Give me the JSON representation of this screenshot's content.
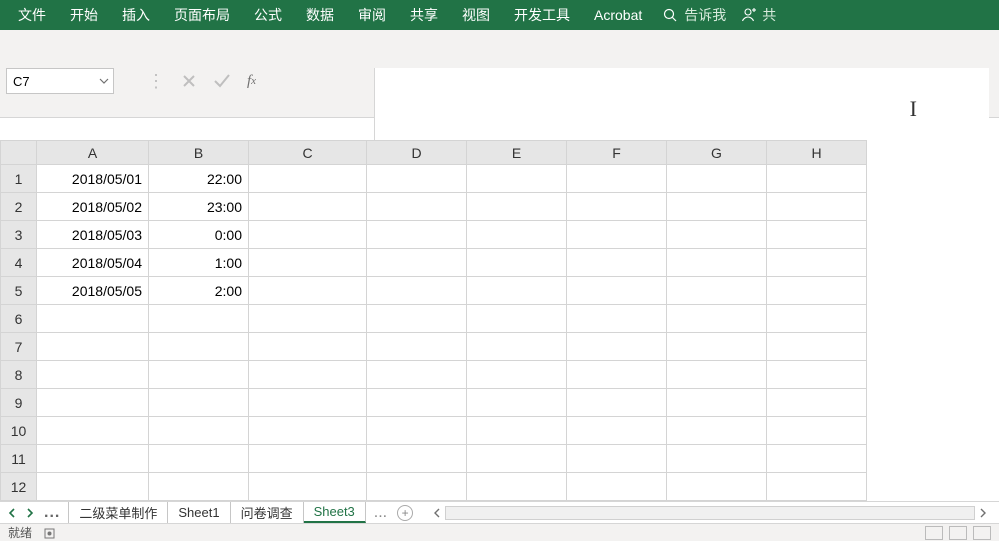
{
  "ribbon": {
    "tabs": [
      "文件",
      "开始",
      "插入",
      "页面布局",
      "公式",
      "数据",
      "审阅",
      "共享",
      "视图",
      "开发工具",
      "Acrobat"
    ],
    "tellme": "告诉我",
    "share_glyph": "共"
  },
  "namebox": {
    "value": "C7"
  },
  "formula": {
    "value": ""
  },
  "columns": [
    "A",
    "B",
    "C",
    "D",
    "E",
    "F",
    "G",
    "H"
  ],
  "row_count": 12,
  "cells": {
    "1": {
      "A": "2018/05/01",
      "B": "22:00"
    },
    "2": {
      "A": "2018/05/02",
      "B": "23:00"
    },
    "3": {
      "A": "2018/05/03",
      "B": "0:00"
    },
    "4": {
      "A": "2018/05/04",
      "B": "1:00"
    },
    "5": {
      "A": "2018/05/05",
      "B": "2:00"
    }
  },
  "sheet_tabs": {
    "items": [
      "二级菜单制作",
      "Sheet1",
      "问卷调查",
      "Sheet3"
    ],
    "active_index": 3,
    "overflow": "..."
  },
  "status": {
    "ready": "就绪"
  }
}
